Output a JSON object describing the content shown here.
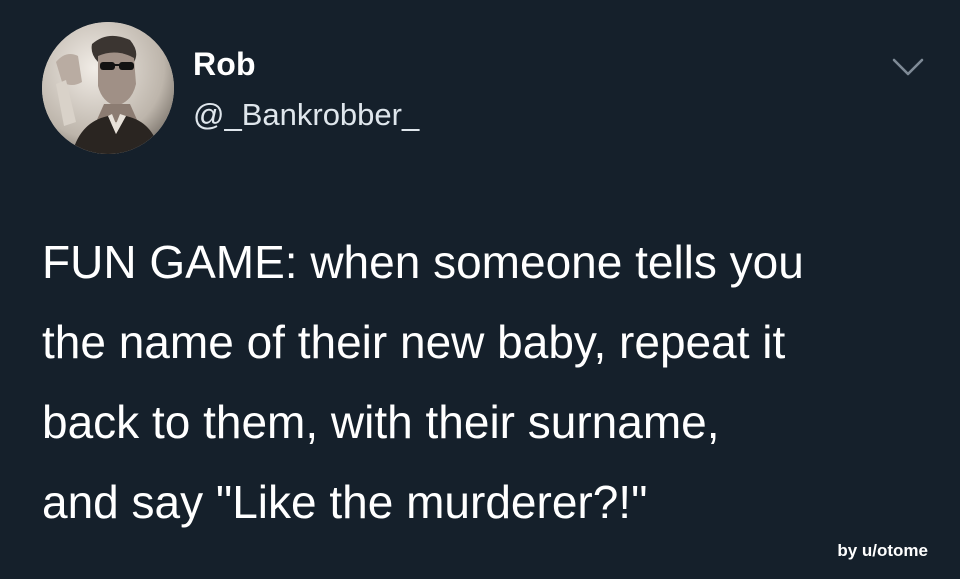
{
  "tweet": {
    "author": {
      "display_name": "Rob",
      "handle": "@_Bankrobber_",
      "avatar_icon": "profile-photo"
    },
    "menu_icon": "chevron-down-icon",
    "text_lines": [
      "FUN GAME: when someone tells you",
      "the name of their new baby, repeat it",
      "back to them, with their surname,",
      "and say \"Like the murderer?!\""
    ]
  },
  "watermark": "by u/otome",
  "colors": {
    "background": "#15202b",
    "text": "#ffffff",
    "secondary_text": "#dfe6ec"
  }
}
